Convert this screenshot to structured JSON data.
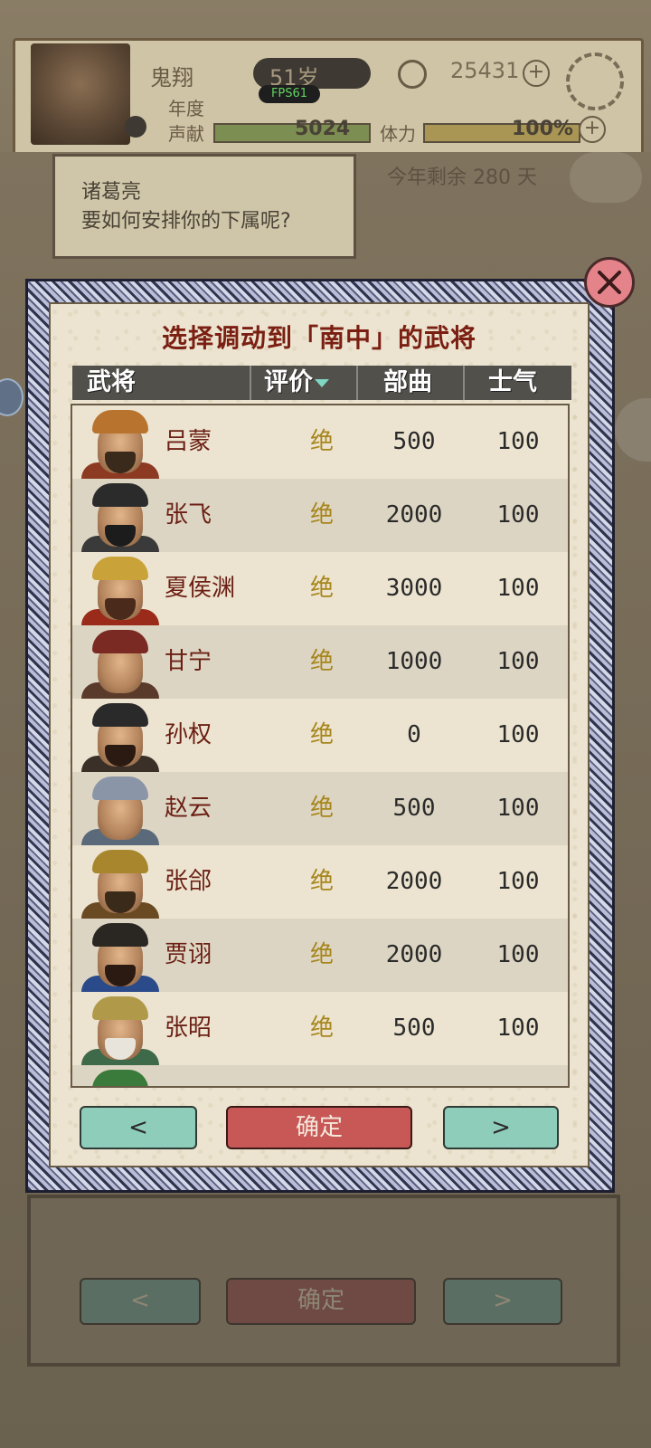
{
  "background": {
    "player_name": "鬼翔",
    "age": "51岁",
    "fps": "FPS61",
    "coins": "25431",
    "label_year": "年度",
    "label_reputation": "声献",
    "reputation_value": "5024",
    "stamina_label": "体力",
    "stamina_value": "100%",
    "speaker": "诸葛亮",
    "prompt": "要如何安排你的下属呢?",
    "remaining": "今年剩余 280 天",
    "ghost_prev": "<",
    "ghost_ok": "确定",
    "ghost_next": ">"
  },
  "dialog": {
    "title": "选择调动到「南中」的武将",
    "columns": {
      "general": "武将",
      "rating": "评价",
      "troops": "部曲",
      "morale": "士气"
    },
    "rows": [
      {
        "name": "吕蒙",
        "rating": "绝",
        "troops": "500",
        "morale": "100"
      },
      {
        "name": "张飞",
        "rating": "绝",
        "troops": "2000",
        "morale": "100"
      },
      {
        "name": "夏侯渊",
        "rating": "绝",
        "troops": "3000",
        "morale": "100"
      },
      {
        "name": "甘宁",
        "rating": "绝",
        "troops": "1000",
        "morale": "100"
      },
      {
        "name": "孙权",
        "rating": "绝",
        "troops": "0",
        "morale": "100"
      },
      {
        "name": "赵云",
        "rating": "绝",
        "troops": "500",
        "morale": "100"
      },
      {
        "name": "张郃",
        "rating": "绝",
        "troops": "2000",
        "morale": "100"
      },
      {
        "name": "贾诩",
        "rating": "绝",
        "troops": "2000",
        "morale": "100"
      },
      {
        "name": "张昭",
        "rating": "绝",
        "troops": "500",
        "morale": "100"
      }
    ],
    "buttons": {
      "prev": "<",
      "confirm": "确定",
      "next": ">"
    }
  },
  "icons": {
    "close": "close-icon",
    "sort": "sort-down-icon"
  },
  "colors": {
    "title": "#7a1f12",
    "name": "#6b1f14",
    "rating": "#a7851a",
    "confirm": "#c75855",
    "nav": "#8fcdbb",
    "close": "#e4848a"
  }
}
